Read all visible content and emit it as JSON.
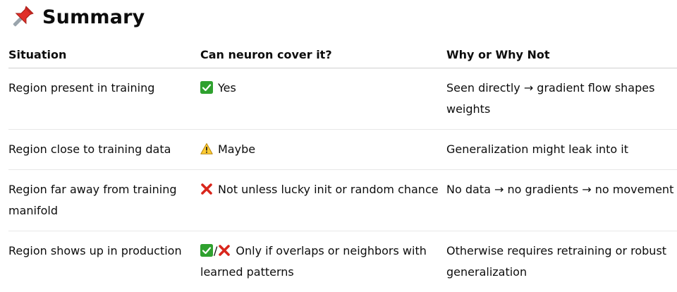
{
  "heading": {
    "icon": "pushpin-icon",
    "title": "Summary"
  },
  "table": {
    "headers": [
      "Situation",
      "Can neuron cover it?",
      "Why or Why Not"
    ],
    "rows": [
      {
        "situation": "Region present in training",
        "verdict_icon": "check-mark-icon",
        "verdict": "Yes",
        "reason": "Seen directly → gradient flow shapes weights"
      },
      {
        "situation": "Region close to training data",
        "verdict_icon": "warning-icon",
        "verdict": "Maybe",
        "reason": "Generalization might leak into it"
      },
      {
        "situation": "Region far away from training manifold",
        "verdict_icon": "cross-mark-icon",
        "verdict": "Not unless lucky init or random chance",
        "reason": "No data → no gradients → no movement"
      },
      {
        "situation": "Region shows up in production",
        "verdict_icon": "check-and-cross-icon",
        "verdict_separator": "/",
        "verdict": "Only if overlaps or neighbors with learned patterns",
        "reason": "Otherwise requires retraining or robust generalization"
      }
    ]
  },
  "colors": {
    "text": "#0d0d0d",
    "check_green": "#2fa12f",
    "cross_red": "#d9261c",
    "warning_yellow": "#ffcc33",
    "pin_red": "#e0302a"
  }
}
